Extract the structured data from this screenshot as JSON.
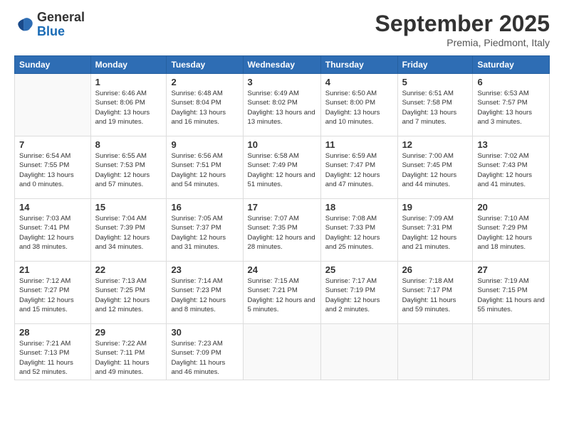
{
  "header": {
    "logo_general": "General",
    "logo_blue": "Blue",
    "month_title": "September 2025",
    "location": "Premia, Piedmont, Italy"
  },
  "weekdays": [
    "Sunday",
    "Monday",
    "Tuesday",
    "Wednesday",
    "Thursday",
    "Friday",
    "Saturday"
  ],
  "weeks": [
    [
      {
        "day": "",
        "info": ""
      },
      {
        "day": "1",
        "info": "Sunrise: 6:46 AM\nSunset: 8:06 PM\nDaylight: 13 hours\nand 19 minutes."
      },
      {
        "day": "2",
        "info": "Sunrise: 6:48 AM\nSunset: 8:04 PM\nDaylight: 13 hours\nand 16 minutes."
      },
      {
        "day": "3",
        "info": "Sunrise: 6:49 AM\nSunset: 8:02 PM\nDaylight: 13 hours\nand 13 minutes."
      },
      {
        "day": "4",
        "info": "Sunrise: 6:50 AM\nSunset: 8:00 PM\nDaylight: 13 hours\nand 10 minutes."
      },
      {
        "day": "5",
        "info": "Sunrise: 6:51 AM\nSunset: 7:58 PM\nDaylight: 13 hours\nand 7 minutes."
      },
      {
        "day": "6",
        "info": "Sunrise: 6:53 AM\nSunset: 7:57 PM\nDaylight: 13 hours\nand 3 minutes."
      }
    ],
    [
      {
        "day": "7",
        "info": "Sunrise: 6:54 AM\nSunset: 7:55 PM\nDaylight: 13 hours\nand 0 minutes."
      },
      {
        "day": "8",
        "info": "Sunrise: 6:55 AM\nSunset: 7:53 PM\nDaylight: 12 hours\nand 57 minutes."
      },
      {
        "day": "9",
        "info": "Sunrise: 6:56 AM\nSunset: 7:51 PM\nDaylight: 12 hours\nand 54 minutes."
      },
      {
        "day": "10",
        "info": "Sunrise: 6:58 AM\nSunset: 7:49 PM\nDaylight: 12 hours\nand 51 minutes."
      },
      {
        "day": "11",
        "info": "Sunrise: 6:59 AM\nSunset: 7:47 PM\nDaylight: 12 hours\nand 47 minutes."
      },
      {
        "day": "12",
        "info": "Sunrise: 7:00 AM\nSunset: 7:45 PM\nDaylight: 12 hours\nand 44 minutes."
      },
      {
        "day": "13",
        "info": "Sunrise: 7:02 AM\nSunset: 7:43 PM\nDaylight: 12 hours\nand 41 minutes."
      }
    ],
    [
      {
        "day": "14",
        "info": "Sunrise: 7:03 AM\nSunset: 7:41 PM\nDaylight: 12 hours\nand 38 minutes."
      },
      {
        "day": "15",
        "info": "Sunrise: 7:04 AM\nSunset: 7:39 PM\nDaylight: 12 hours\nand 34 minutes."
      },
      {
        "day": "16",
        "info": "Sunrise: 7:05 AM\nSunset: 7:37 PM\nDaylight: 12 hours\nand 31 minutes."
      },
      {
        "day": "17",
        "info": "Sunrise: 7:07 AM\nSunset: 7:35 PM\nDaylight: 12 hours\nand 28 minutes."
      },
      {
        "day": "18",
        "info": "Sunrise: 7:08 AM\nSunset: 7:33 PM\nDaylight: 12 hours\nand 25 minutes."
      },
      {
        "day": "19",
        "info": "Sunrise: 7:09 AM\nSunset: 7:31 PM\nDaylight: 12 hours\nand 21 minutes."
      },
      {
        "day": "20",
        "info": "Sunrise: 7:10 AM\nSunset: 7:29 PM\nDaylight: 12 hours\nand 18 minutes."
      }
    ],
    [
      {
        "day": "21",
        "info": "Sunrise: 7:12 AM\nSunset: 7:27 PM\nDaylight: 12 hours\nand 15 minutes."
      },
      {
        "day": "22",
        "info": "Sunrise: 7:13 AM\nSunset: 7:25 PM\nDaylight: 12 hours\nand 12 minutes."
      },
      {
        "day": "23",
        "info": "Sunrise: 7:14 AM\nSunset: 7:23 PM\nDaylight: 12 hours\nand 8 minutes."
      },
      {
        "day": "24",
        "info": "Sunrise: 7:15 AM\nSunset: 7:21 PM\nDaylight: 12 hours\nand 5 minutes."
      },
      {
        "day": "25",
        "info": "Sunrise: 7:17 AM\nSunset: 7:19 PM\nDaylight: 12 hours\nand 2 minutes."
      },
      {
        "day": "26",
        "info": "Sunrise: 7:18 AM\nSunset: 7:17 PM\nDaylight: 11 hours\nand 59 minutes."
      },
      {
        "day": "27",
        "info": "Sunrise: 7:19 AM\nSunset: 7:15 PM\nDaylight: 11 hours\nand 55 minutes."
      }
    ],
    [
      {
        "day": "28",
        "info": "Sunrise: 7:21 AM\nSunset: 7:13 PM\nDaylight: 11 hours\nand 52 minutes."
      },
      {
        "day": "29",
        "info": "Sunrise: 7:22 AM\nSunset: 7:11 PM\nDaylight: 11 hours\nand 49 minutes."
      },
      {
        "day": "30",
        "info": "Sunrise: 7:23 AM\nSunset: 7:09 PM\nDaylight: 11 hours\nand 46 minutes."
      },
      {
        "day": "",
        "info": ""
      },
      {
        "day": "",
        "info": ""
      },
      {
        "day": "",
        "info": ""
      },
      {
        "day": "",
        "info": ""
      }
    ]
  ]
}
